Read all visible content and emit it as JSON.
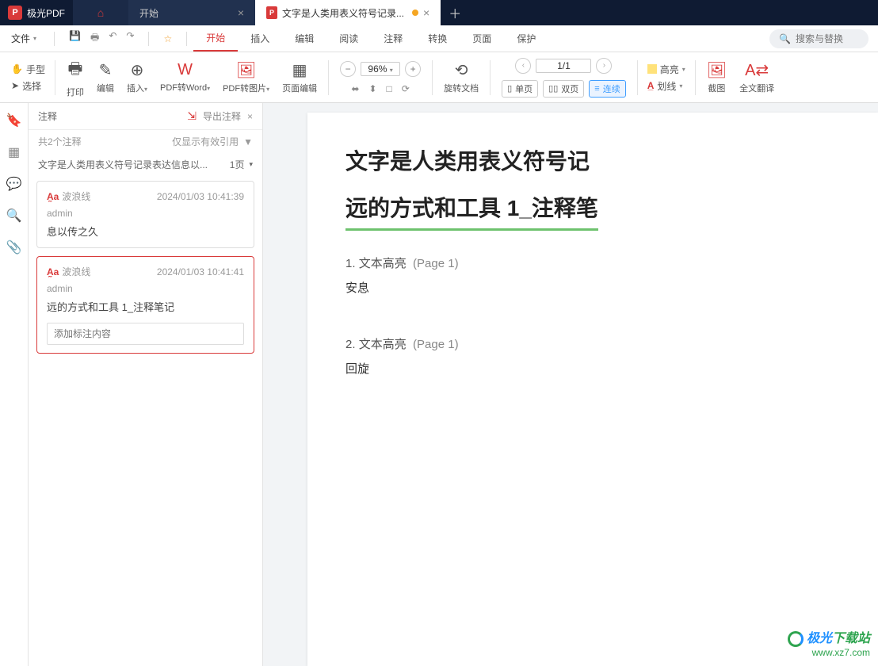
{
  "app": {
    "name": "极光PDF"
  },
  "tabs": {
    "start": "开始",
    "doc": "文字是人类用表义符号记录..."
  },
  "file_menu": "文件",
  "menus": [
    "开始",
    "插入",
    "编辑",
    "阅读",
    "注释",
    "转换",
    "页面",
    "保护"
  ],
  "search": {
    "placeholder": "搜索与替换"
  },
  "toolbar": {
    "hand": "手型",
    "select": "选择",
    "print": "打印",
    "edit": "编辑",
    "insert": "插入",
    "pdf2word": "PDF转Word",
    "pdf2img": "PDF转图片",
    "pageedit": "页面编辑",
    "zoom": "96%",
    "rotate": "旋转文档",
    "page": "1/1",
    "single": "单页",
    "double": "双页",
    "continuous": "连续",
    "highlight": "高亮",
    "strikeline": "划线",
    "screenshot": "截图",
    "translate": "全文翻译"
  },
  "panel": {
    "title": "注释",
    "export": "导出注释",
    "count": "共2个注释",
    "filter": "仅显示有效引用",
    "doc_name": "文字是人类用表义符号记录表达信息以...",
    "doc_page": "1页"
  },
  "annotations": [
    {
      "type": "波浪线",
      "time": "2024/01/03 10:41:39",
      "user": "admin",
      "text": "息以传之久"
    },
    {
      "type": "波浪线",
      "time": "2024/01/03 10:41:41",
      "user": "admin",
      "text": "远的方式和工具 1_注释笔记",
      "input_placeholder": "添加标注内容"
    }
  ],
  "document": {
    "title_line1": "文字是人类用表义符号记",
    "title_line2": "远的方式和工具 1_注释笔",
    "entries": [
      {
        "idx": "1.",
        "label": "文本高亮",
        "page": "(Page 1)",
        "body": "安息"
      },
      {
        "idx": "2.",
        "label": "文本高亮",
        "page": "(Page 1)",
        "body": "回旋"
      }
    ]
  },
  "watermark": {
    "line1a": "极光",
    "line1b": "下载站",
    "line2": "www.xz7.com"
  }
}
